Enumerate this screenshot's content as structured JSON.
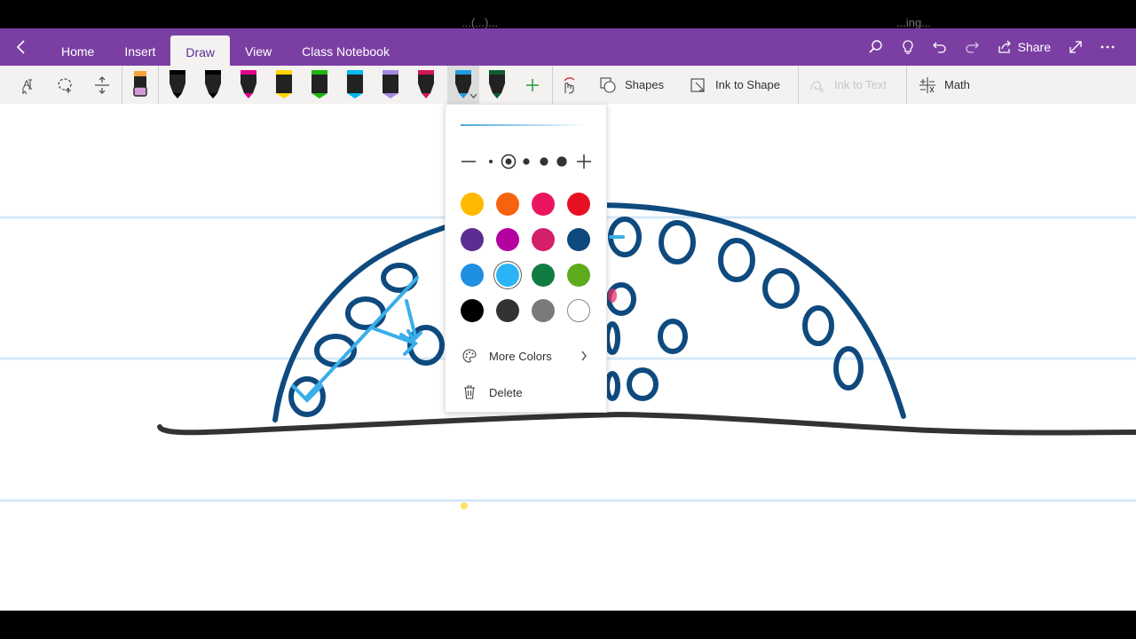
{
  "window": {
    "title_fragments": [
      "...(...)...",
      "...ing..."
    ]
  },
  "ribbon": {
    "tabs": [
      {
        "label": "Home",
        "active": false
      },
      {
        "label": "Insert",
        "active": false
      },
      {
        "label": "Draw",
        "active": true
      },
      {
        "label": "View",
        "active": false
      },
      {
        "label": "Class Notebook",
        "active": false
      }
    ],
    "share_label": "Share"
  },
  "toolbar": {
    "shapes_label": "Shapes",
    "ink_to_shape_label": "Ink to Shape",
    "ink_to_text_label": "Ink to Text",
    "math_label": "Math",
    "pen_colors": [
      "#000000",
      "#000000",
      "#e3008c",
      "#ffd500",
      "#1fb50f",
      "#00b7f0",
      "#a58be0",
      "#d4145a",
      "#1e9de0",
      "#0e5c2f"
    ]
  },
  "pen_menu": {
    "preview_color": "#4aa8dc",
    "swatches": [
      "#ffb900",
      "#f7630c",
      "#ea1561",
      "#e81123",
      "#5c2e91",
      "#b4009e",
      "#d41f6b",
      "#0e4a7e",
      "#1e8fe1",
      "#2ab4f5",
      "#107c41",
      "#5fab1e",
      "#000000",
      "#333333",
      "#7a7a7a",
      "#ffffff"
    ],
    "selected_swatch_index": 9,
    "more_colors_label": "More Colors",
    "delete_label": "Delete"
  },
  "colors": {
    "ribbon": "#7b3fa3",
    "ink_navy": "#0e4a7e",
    "ink_light_blue": "#3aaee8",
    "ink_black": "#333333",
    "rule_line": "#cfe6f6"
  }
}
